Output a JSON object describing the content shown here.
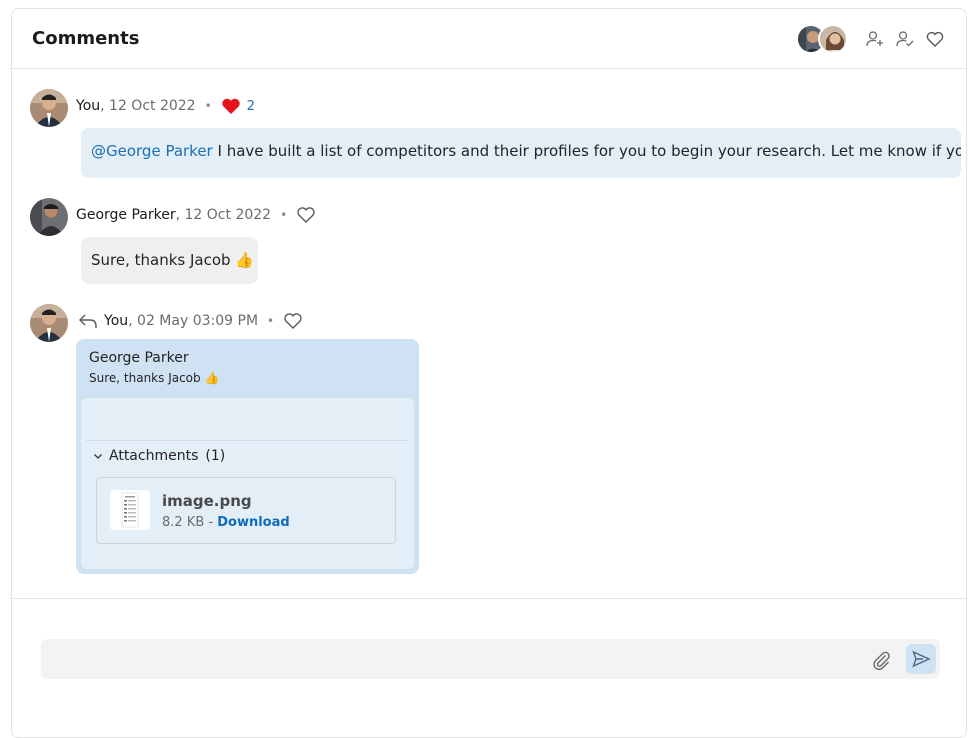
{
  "header": {
    "title": "Comments"
  },
  "comments": [
    {
      "author": "You",
      "date": ", 12 Oct 2022",
      "separator": "•",
      "like_count": "2",
      "mention": "@George Parker",
      "text": " I have built a list of competitors and their profiles for you to begin your research. Let me know if you need anything else."
    },
    {
      "author": "George Parker",
      "date": ", 12 Oct 2022",
      "separator": "•",
      "text": "Sure, thanks Jacob 👍"
    },
    {
      "author": "You",
      "date": ", 02 May 03:09 PM",
      "separator": "•",
      "quote_author": "George Parker",
      "quote_text": "Sure, thanks Jacob 👍",
      "attachments_label": "Attachments",
      "attachments_count": "(1)",
      "file": {
        "name": "image.png",
        "size": "8.2 KB - ",
        "download_label": "Download"
      }
    }
  ],
  "colors": {
    "accent": "#0f6cbd",
    "heart_liked": "#e3121b",
    "bubble_mine": "#e3eef7",
    "bubble_other": "#efefef"
  }
}
